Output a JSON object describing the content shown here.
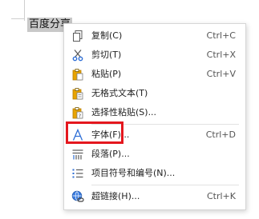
{
  "document": {
    "selected_text": "百度分享"
  },
  "context_menu": {
    "items": [
      {
        "label": "复制(C)",
        "shortcut": "Ctrl+C",
        "icon": "copy-icon"
      },
      {
        "label": "剪切(T)",
        "shortcut": "Ctrl+X",
        "icon": "scissors-icon"
      },
      {
        "label": "粘贴(P)",
        "shortcut": "Ctrl+V",
        "icon": "paste-icon"
      },
      {
        "label": "无格式文本(T)",
        "shortcut": "",
        "icon": "paste-plain-text-icon"
      },
      {
        "label": "选择性粘贴(S)...",
        "shortcut": "",
        "icon": "paste-special-icon"
      },
      {
        "label": "字体(F)...",
        "shortcut": "Ctrl+D",
        "icon": "font-icon"
      },
      {
        "label": "段落(P)...",
        "shortcut": "",
        "icon": "paragraph-icon"
      },
      {
        "label": "项目符号和编号(N)...",
        "shortcut": "",
        "icon": "bullet-list-icon"
      },
      {
        "label": "超链接(H)...",
        "shortcut": "Ctrl+K",
        "icon": "hyperlink-icon"
      }
    ]
  },
  "annotation": {
    "highlight_color": "#e4171e"
  }
}
